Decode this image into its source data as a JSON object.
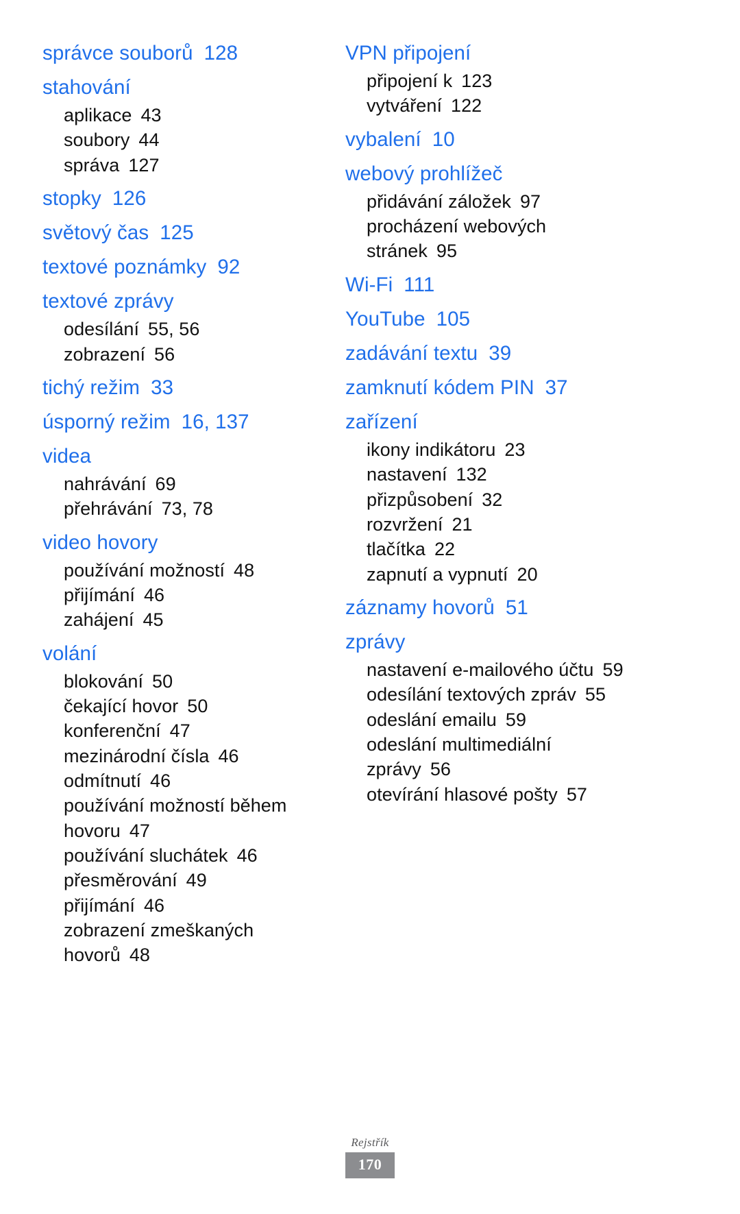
{
  "document": {
    "type": "index",
    "language": "cs",
    "accent_color": "#1f6fea",
    "sub_color": "#111111",
    "footer": {
      "label": "Rejstřík",
      "page_number": "170",
      "badge_color": "#8c8d90"
    }
  },
  "columns": [
    {
      "name": "left-column",
      "entries": [
        {
          "term": "správce souborů",
          "pages": "128",
          "subs": []
        },
        {
          "term": "stahování",
          "pages": "",
          "subs": [
            {
              "term": "aplikace",
              "pages": "43"
            },
            {
              "term": "soubory",
              "pages": "44"
            },
            {
              "term": "správa",
              "pages": "127"
            }
          ]
        },
        {
          "term": "stopky",
          "pages": "126",
          "subs": []
        },
        {
          "term": "světový čas",
          "pages": "125",
          "subs": []
        },
        {
          "term": "textové poznámky",
          "pages": "92",
          "subs": []
        },
        {
          "term": "textové zprávy",
          "pages": "",
          "subs": [
            {
              "term": "odesílání",
              "pages": "55, 56"
            },
            {
              "term": "zobrazení",
              "pages": "56"
            }
          ]
        },
        {
          "term": "tichý režim",
          "pages": "33",
          "subs": []
        },
        {
          "term": "úsporný režim",
          "pages": "16, 137",
          "subs": []
        },
        {
          "term": "videa",
          "pages": "",
          "subs": [
            {
              "term": "nahrávání",
              "pages": "69"
            },
            {
              "term": "přehrávání",
              "pages": "73, 78"
            }
          ]
        },
        {
          "term": "video hovory",
          "pages": "",
          "subs": [
            {
              "term": "používání možností",
              "pages": "48"
            },
            {
              "term": "přijímání",
              "pages": "46"
            },
            {
              "term": "zahájení",
              "pages": "45"
            }
          ]
        },
        {
          "term": "volání",
          "pages": "",
          "subs": [
            {
              "term": "blokování",
              "pages": "50"
            },
            {
              "term": "čekající hovor",
              "pages": "50"
            },
            {
              "term": "konferenční",
              "pages": "47"
            },
            {
              "term": "mezinárodní čísla",
              "pages": "46"
            },
            {
              "term": "odmítnutí",
              "pages": "46"
            },
            {
              "term": "používání možností během hovoru",
              "pages": "47"
            },
            {
              "term": "používání sluchátek",
              "pages": "46"
            },
            {
              "term": "přesměrování",
              "pages": "49"
            },
            {
              "term": "přijímání",
              "pages": "46"
            },
            {
              "term": "zobrazení zmeškaných hovorů",
              "pages": "48"
            }
          ]
        }
      ]
    },
    {
      "name": "right-column",
      "entries": [
        {
          "term": "VPN připojení",
          "pages": "",
          "subs": [
            {
              "term": "připojení k",
              "pages": "123"
            },
            {
              "term": "vytváření",
              "pages": "122"
            }
          ]
        },
        {
          "term": "vybalení",
          "pages": "10",
          "subs": []
        },
        {
          "term": "webový prohlížeč",
          "pages": "",
          "subs": [
            {
              "term": "přidávání záložek",
              "pages": "97"
            },
            {
              "term": "procházení webových stránek",
              "pages": "95"
            }
          ]
        },
        {
          "term": "Wi-Fi",
          "pages": "111",
          "subs": []
        },
        {
          "term": "YouTube",
          "pages": "105",
          "subs": []
        },
        {
          "term": "zadávání textu",
          "pages": "39",
          "subs": []
        },
        {
          "term": "zamknutí kódem PIN",
          "pages": "37",
          "subs": []
        },
        {
          "term": "zařízení",
          "pages": "",
          "subs": [
            {
              "term": "ikony indikátoru",
              "pages": "23"
            },
            {
              "term": "nastavení",
              "pages": "132"
            },
            {
              "term": "přizpůsobení",
              "pages": "32"
            },
            {
              "term": "rozvržení",
              "pages": "21"
            },
            {
              "term": "tlačítka",
              "pages": "22"
            },
            {
              "term": "zapnutí a vypnutí",
              "pages": "20"
            }
          ]
        },
        {
          "term": "záznamy hovorů",
          "pages": "51",
          "subs": []
        },
        {
          "term": "zprávy",
          "pages": "",
          "subs": [
            {
              "term": "nastavení e-mailového účtu",
              "pages": "59"
            },
            {
              "term": "odesílání textových zpráv",
              "pages": "55"
            },
            {
              "term": "odeslání emailu",
              "pages": "59"
            },
            {
              "term": "odeslání multimediální zprávy",
              "pages": "56"
            },
            {
              "term": "otevírání hlasové pošty",
              "pages": "57"
            }
          ]
        }
      ]
    }
  ]
}
